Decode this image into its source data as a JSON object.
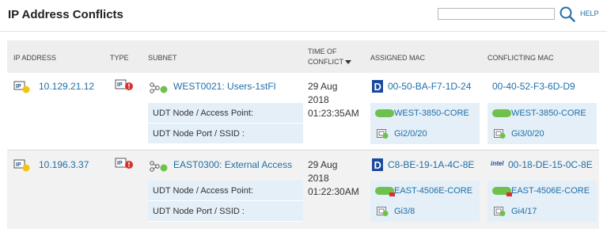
{
  "page": {
    "title": "IP Address Conflicts"
  },
  "search": {
    "value": "",
    "placeholder": ""
  },
  "help_label": "HELP",
  "columns": {
    "ip": "IP ADDRESS",
    "type": "TYPE",
    "subnet": "SUBNET",
    "time_line1": "TIME OF",
    "time_line2": "CONFLICT",
    "assigned": "ASSIGNED MAC",
    "conflicting": "CONFLICTING MAC"
  },
  "labels": {
    "access_point": "UDT Node / Access Point:",
    "port_ssid": "UDT Node Port / SSID :"
  },
  "rows": [
    {
      "ip": "10.129.21.12",
      "subnet": "WEST0021: Users-1stFl",
      "date_line1": "29 Aug",
      "date_line2": "2018",
      "time": "01:23:35AM",
      "assigned": {
        "mac": "00-50-BA-F7-1D-24",
        "vendor_icon": "dlink-logo-icon",
        "node": "WEST-3850-CORE",
        "node_status": "up",
        "port": "Gi2/0/20"
      },
      "conflicting": {
        "mac": "00-40-52-F3-6D-D9",
        "vendor_icon": "",
        "node": "WEST-3850-CORE",
        "node_status": "up",
        "port": "Gi3/0/20"
      }
    },
    {
      "ip": "10.196.3.37",
      "subnet": "EAST0300: External Access",
      "date_line1": "29 Aug",
      "date_line2": "2018",
      "time": "01:22:30AM",
      "assigned": {
        "mac": "C8-BE-19-1A-4C-8E",
        "vendor_icon": "dlink-logo-icon",
        "node": "EAST-4506E-CORE",
        "node_status": "warning",
        "port": "Gi3/8"
      },
      "conflicting": {
        "mac": "00-18-DE-15-0C-8E",
        "vendor_icon": "intel-logo-icon",
        "vendor_text": "intel",
        "node": "EAST-4506E-CORE",
        "node_status": "warning",
        "port": "Gi4/17"
      }
    }
  ],
  "colors": {
    "link": "#1f6fa8",
    "status_up": "#6fc14d",
    "status_warning": "#d9302c",
    "label_bg": "#e4eff8"
  }
}
